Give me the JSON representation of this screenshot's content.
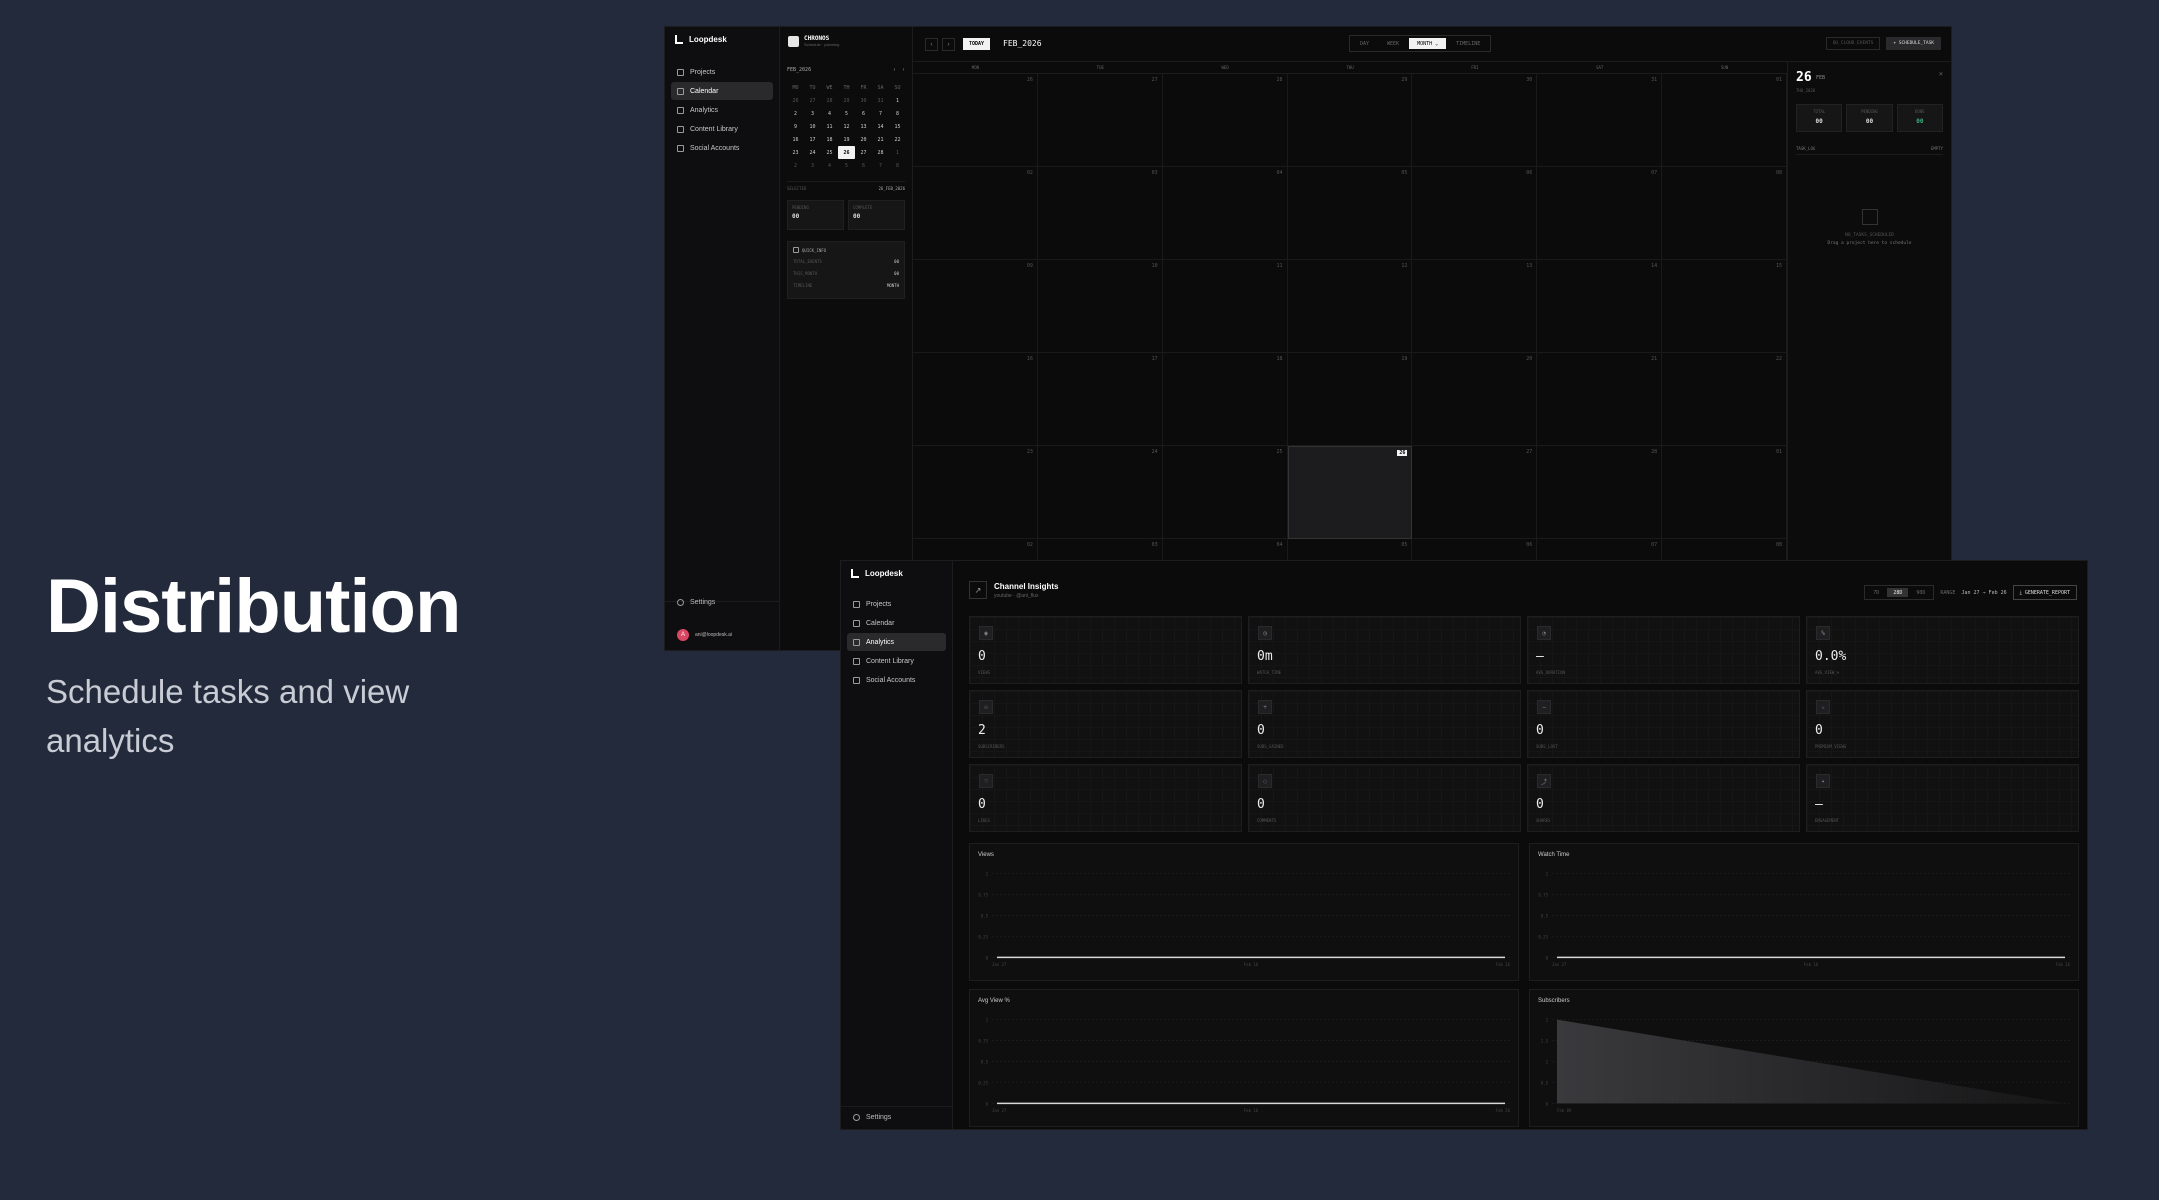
{
  "hero": {
    "title": "Distribution",
    "subtitle": "Schedule tasks and view analytics"
  },
  "calendar_app": {
    "brand": "Loopdesk",
    "nav": [
      {
        "label": "Projects",
        "icon": "home-icon"
      },
      {
        "label": "Calendar",
        "icon": "calendar-icon",
        "active": true
      },
      {
        "label": "Analytics",
        "icon": "chart-icon"
      },
      {
        "label": "Content Library",
        "icon": "folder-icon"
      },
      {
        "label": "Social Accounts",
        "icon": "users-icon"
      }
    ],
    "settings_label": "Settings",
    "user": {
      "initial": "A",
      "email": "ani@loopdesk.ai"
    },
    "mini": {
      "app_title": "CHRONOS",
      "app_subtitle": "Schedule · planning",
      "month_label": "FEB_2026",
      "weekdays": [
        "MO",
        "TU",
        "WE",
        "TH",
        "FR",
        "SA",
        "SU"
      ],
      "days": [
        {
          "d": "26",
          "dim": true
        },
        {
          "d": "27",
          "dim": true
        },
        {
          "d": "28",
          "dim": true
        },
        {
          "d": "29",
          "dim": true
        },
        {
          "d": "30",
          "dim": true
        },
        {
          "d": "31",
          "dim": true
        },
        {
          "d": "1"
        },
        {
          "d": "2"
        },
        {
          "d": "3"
        },
        {
          "d": "4"
        },
        {
          "d": "5"
        },
        {
          "d": "6"
        },
        {
          "d": "7"
        },
        {
          "d": "8"
        },
        {
          "d": "9"
        },
        {
          "d": "10"
        },
        {
          "d": "11"
        },
        {
          "d": "12"
        },
        {
          "d": "13"
        },
        {
          "d": "14"
        },
        {
          "d": "15"
        },
        {
          "d": "16"
        },
        {
          "d": "17"
        },
        {
          "d": "18"
        },
        {
          "d": "19"
        },
        {
          "d": "20"
        },
        {
          "d": "21"
        },
        {
          "d": "22"
        },
        {
          "d": "23"
        },
        {
          "d": "24"
        },
        {
          "d": "25"
        },
        {
          "d": "26",
          "sel": true
        },
        {
          "d": "27"
        },
        {
          "d": "28"
        },
        {
          "d": "1",
          "dim": true
        },
        {
          "d": "2",
          "dim": true
        },
        {
          "d": "3",
          "dim": true
        },
        {
          "d": "4",
          "dim": true
        },
        {
          "d": "5",
          "dim": true
        },
        {
          "d": "6",
          "dim": true
        },
        {
          "d": "7",
          "dim": true
        },
        {
          "d": "8",
          "dim": true
        }
      ],
      "selected_label": "SELECTED",
      "selected_value": "26_FEB_2026",
      "stats": [
        {
          "k": "PENDING",
          "v": "00"
        },
        {
          "k": "COMPLETE",
          "v": "00"
        }
      ],
      "quick_info_title": "QUICK_INFO",
      "quick_info": [
        {
          "k": "TOTAL_EVENTS",
          "v": "00"
        },
        {
          "k": "THIS_MONTH",
          "v": "00"
        },
        {
          "k": "TIMELINE",
          "v": "MONTH"
        }
      ]
    },
    "toolbar": {
      "today": "TODAY",
      "title": "FEB_2026",
      "views": [
        "DAY",
        "WEEK",
        "MONTH",
        "TIMELINE"
      ],
      "active_view": "MONTH",
      "quota": "QU_CLOUD_EVENTS",
      "schedule": "SCHEDULE_TASK"
    },
    "dow": [
      "MON",
      "TUE",
      "WED",
      "THU",
      "FRI",
      "SAT",
      "SUN"
    ],
    "month_cells": [
      "26",
      "27",
      "28",
      "29",
      "30",
      "31",
      "01",
      "02",
      "03",
      "04",
      "05",
      "06",
      "07",
      "08",
      "09",
      "10",
      "11",
      "12",
      "13",
      "14",
      "15",
      "16",
      "17",
      "18",
      "19",
      "20",
      "21",
      "22",
      "23",
      "24",
      "25",
      "26",
      "27",
      "28",
      "01",
      "02",
      "03",
      "04",
      "05",
      "06",
      "07",
      "08"
    ],
    "highlight_index": 31,
    "day_panel": {
      "day": "26",
      "month": "FEB",
      "sub": "THU_2026",
      "stats": [
        {
          "k": "TOTAL",
          "v": "00"
        },
        {
          "k": "PENDING",
          "v": "00"
        },
        {
          "k": "DONE",
          "v": "00"
        }
      ],
      "log_title": "TASK_LOG",
      "log_right": "EMPTY",
      "empty_title": "NO_TASKS_SCHEDULED",
      "empty_sub": "Drag a project here to schedule"
    }
  },
  "analytics_app": {
    "brand": "Loopdesk",
    "nav": [
      {
        "label": "Projects",
        "icon": "home-icon"
      },
      {
        "label": "Calendar",
        "icon": "calendar-icon"
      },
      {
        "label": "Analytics",
        "icon": "chart-icon",
        "active": true
      },
      {
        "label": "Content Library",
        "icon": "folder-icon"
      },
      {
        "label": "Social Accounts",
        "icon": "users-icon"
      }
    ],
    "settings_label": "Settings",
    "header": {
      "title": "Channel Insights",
      "subtitle": "youtube · @ani_flux"
    },
    "ranges": [
      "7D",
      "28D",
      "90D"
    ],
    "active_range": "28D",
    "range_label": "RANGE",
    "range_value": "Jan 27 → Feb 26",
    "generate": "GENERATE_REPORT",
    "metrics": [
      {
        "v": "0",
        "k": "VIEWS",
        "icon": "eye-icon"
      },
      {
        "v": "0m",
        "k": "WATCH_TIME",
        "icon": "clock-icon"
      },
      {
        "v": "—",
        "k": "AVG_DURATION",
        "icon": "timer-icon"
      },
      {
        "v": "0.0%",
        "k": "AVG_VIEW_%",
        "icon": "percent-icon"
      },
      {
        "v": "2",
        "k": "SUBSCRIBERS",
        "icon": "users-icon"
      },
      {
        "v": "0",
        "k": "SUBS_GAINED",
        "icon": "user-plus-icon"
      },
      {
        "v": "0",
        "k": "SUBS_LOST",
        "icon": "user-minus-icon"
      },
      {
        "v": "0",
        "k": "PREMIUM_VIEWS",
        "icon": "star-icon"
      },
      {
        "v": "0",
        "k": "LIKES",
        "icon": "heart-icon"
      },
      {
        "v": "0",
        "k": "COMMENTS",
        "icon": "comment-icon"
      },
      {
        "v": "0",
        "k": "SHARES",
        "icon": "share-icon"
      },
      {
        "v": "—",
        "k": "ENGAGEMENT",
        "icon": "sparkle-icon"
      }
    ]
  },
  "chart_data": [
    {
      "type": "line",
      "title": "Views",
      "x": [
        "Jan 27",
        "Feb 26"
      ],
      "x_ticks": [
        "Jan 27",
        "Feb 16",
        "Feb 26"
      ],
      "yticks": [
        "1",
        "0.75",
        "0.5",
        "0.25",
        "0"
      ],
      "ylim": [
        0,
        1
      ],
      "values": [
        0,
        0
      ]
    },
    {
      "type": "line",
      "title": "Watch Time",
      "x": [
        "Jan 27",
        "Feb 26"
      ],
      "x_ticks": [
        "Jan 27",
        "Feb 16",
        "Feb 26"
      ],
      "yticks": [
        "1",
        "0.75",
        "0.5",
        "0.25",
        "0"
      ],
      "ylim": [
        0,
        1
      ],
      "values": [
        0,
        0
      ]
    },
    {
      "type": "line",
      "title": "Avg View %",
      "x": [
        "Jan 27",
        "Feb 26"
      ],
      "x_ticks": [
        "Jan 27",
        "Feb 16",
        "Feb 26"
      ],
      "yticks": [
        "1",
        "0.75",
        "0.5",
        "0.25",
        "0"
      ],
      "ylim": [
        0,
        1
      ],
      "values": [
        0,
        0
      ]
    },
    {
      "type": "area",
      "title": "Subscribers",
      "x": [
        "Feb 09",
        "Feb 26"
      ],
      "x_ticks": [
        "Feb 09"
      ],
      "yticks": [
        "2",
        "1.5",
        "1",
        "0.5",
        "0"
      ],
      "ylim": [
        0,
        2
      ],
      "values": [
        2,
        0
      ]
    }
  ]
}
